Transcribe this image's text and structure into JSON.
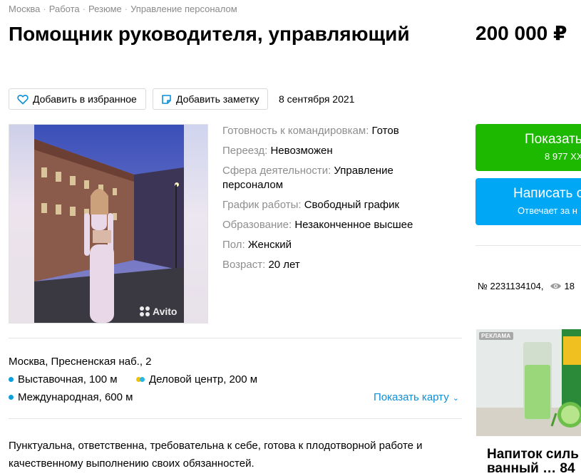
{
  "breadcrumb": [
    "Москва",
    "Работа",
    "Резюме",
    "Управление персоналом"
  ],
  "title": "Помощник руководителя, управляющий",
  "price": "200 000 ₽",
  "actions": {
    "favorite": "Добавить в избранное",
    "note": "Добавить заметку"
  },
  "date": "8 сентября 2021",
  "photo": {
    "watermark": "Avito"
  },
  "params": [
    {
      "key": "Готовность к командировкам:",
      "value": "Готов"
    },
    {
      "key": "Переезд:",
      "value": "Невозможен"
    },
    {
      "key": "Сфера деятельности:",
      "value": "Управление персоналом"
    },
    {
      "key": "График работы:",
      "value": "Свободный график"
    },
    {
      "key": "Образование:",
      "value": "Незаконченное высшее"
    },
    {
      "key": "Пол:",
      "value": "Женский"
    },
    {
      "key": "Возраст:",
      "value": "20 лет"
    }
  ],
  "address": "Москва, Пресненская наб., 2",
  "metro": [
    {
      "name": "Выставочная, 100 м",
      "colors": [
        "#0aa0e0"
      ]
    },
    {
      "name": "Деловой центр, 200 м",
      "colors": [
        "#f2c100",
        "#2ab5e8"
      ]
    },
    {
      "name": "Международная, 600 м",
      "colors": [
        "#0aa0e0"
      ]
    }
  ],
  "map_link": "Показать карту",
  "description": "Пунктуальна, ответственна, требовательна к себе, готова к плодотворной работе и качественному выполнению своих обязанностей.",
  "cta": {
    "phone_label": "Показать",
    "phone_sub": "8 977 XX",
    "write_label": "Написать с",
    "write_sub": "Отвечает за н"
  },
  "item": {
    "number": "№ 2231134104,",
    "views": "18"
  },
  "ad": {
    "label": "РЕКЛАМА",
    "title": "Напиток силь",
    "title2": "ванный … 84"
  },
  "colors": {
    "green": "#1db900",
    "blue": "#00a7f5",
    "link": "#0a8fd8"
  }
}
